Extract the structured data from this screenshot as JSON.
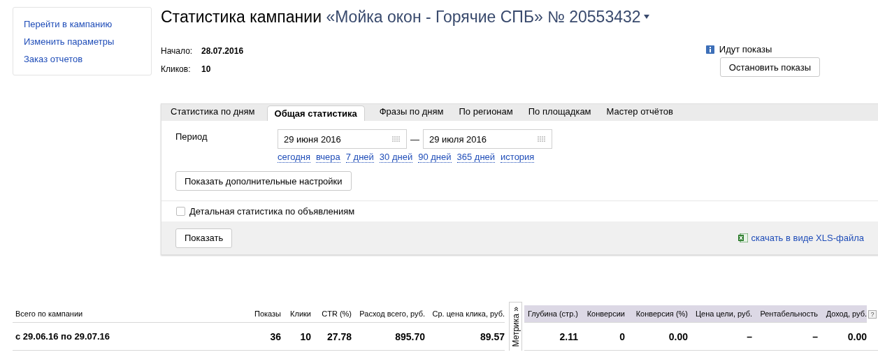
{
  "sidebar": {
    "links": [
      "Перейти в кампанию",
      "Изменить параметры",
      "Заказ отчетов"
    ]
  },
  "title": {
    "prefix": "Статистика кампании",
    "campaign": "«Мойка окон - Горячие СПБ» № 20553432"
  },
  "summary": [
    {
      "label": "Начало:",
      "value": "28.07.2016"
    },
    {
      "label": "Кликов:",
      "value": "10"
    }
  ],
  "status": {
    "text": "Идут показы",
    "button": "Остановить показы"
  },
  "tabs": [
    {
      "label": "Статистика по дням",
      "selected": false
    },
    {
      "label": "Общая статистика",
      "selected": true
    },
    {
      "label": "Фразы по дням",
      "selected": false
    },
    {
      "label": "По регионам",
      "selected": false
    },
    {
      "label": "По площадкам",
      "selected": false
    },
    {
      "label": "Мастер отчётов",
      "selected": false
    }
  ],
  "period": {
    "label": "Период",
    "from": "29 июня 2016",
    "separator": "—",
    "to": "29 июля 2016",
    "presets": [
      "сегодня",
      "вчера",
      "7 дней",
      "30 дней",
      "90 дней",
      "365 дней",
      "история"
    ]
  },
  "more_settings_button": "Показать дополнительные настройки",
  "detail_checkbox": {
    "label": "Детальная статистика по объявлениям",
    "checked": false
  },
  "show_button": "Показать",
  "xls_link": "скачать в виде XLS-файла",
  "table": {
    "metrika_tab": "Метрика »",
    "help": "?",
    "columns": [
      {
        "label": "Всего по кампании",
        "kind": "main"
      },
      {
        "label": "Показы",
        "kind": "main"
      },
      {
        "label": "Клики",
        "kind": "main"
      },
      {
        "label": "CTR (%)",
        "kind": "main"
      },
      {
        "label": "Расход всего, руб.",
        "kind": "main"
      },
      {
        "label": "Ср. цена клика, руб.",
        "kind": "main"
      },
      {
        "label": "Глубина (стр.)",
        "kind": "metrika"
      },
      {
        "label": "Конверсии",
        "kind": "metrika"
      },
      {
        "label": "Конверсия (%)",
        "kind": "metrika"
      },
      {
        "label": "Цена цели, руб.",
        "kind": "metrika"
      },
      {
        "label": "Рентабельность",
        "kind": "metrika"
      },
      {
        "label": "Доход, руб.",
        "kind": "metrika"
      }
    ],
    "rows": [
      {
        "cells": [
          "с 29.06.16 по 29.07.16",
          "36",
          "10",
          "27.78",
          "895.70",
          "89.57",
          "2.11",
          "0",
          "0.00",
          "–",
          "–",
          "0.00"
        ]
      }
    ]
  }
}
